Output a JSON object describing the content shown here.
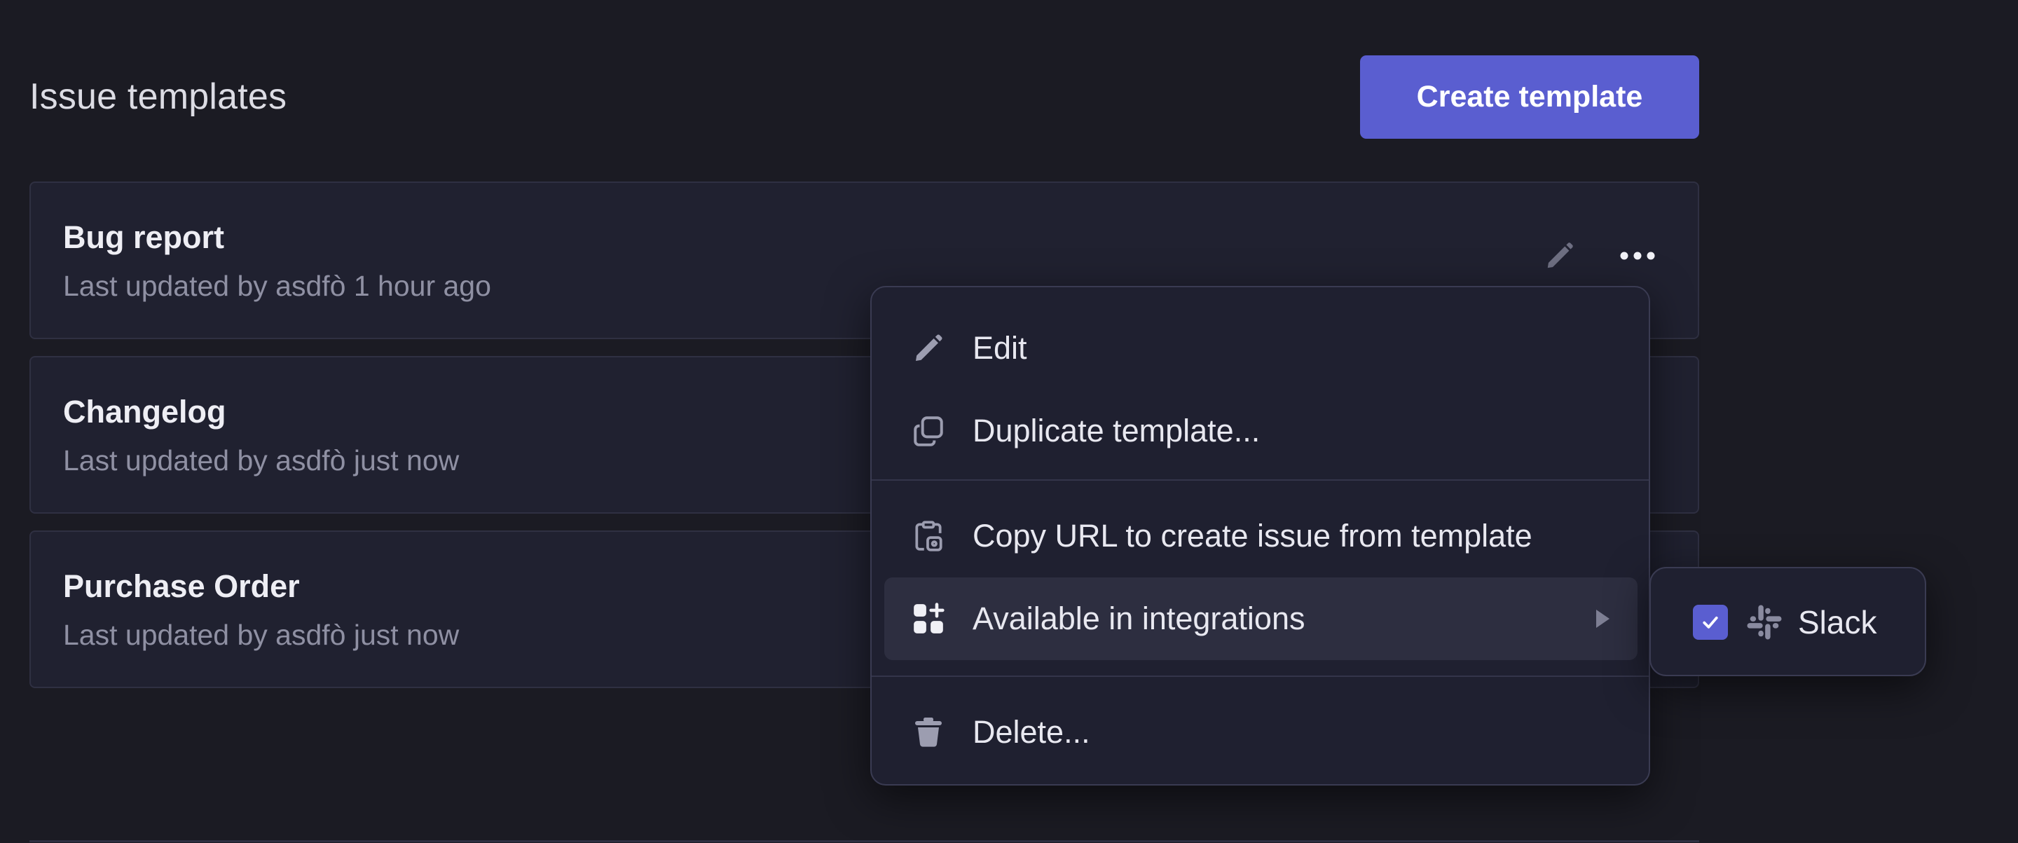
{
  "page": {
    "title": "Issue templates",
    "create_button_label": "Create template"
  },
  "templates": [
    {
      "name": "Bug report",
      "meta": "Last updated by asdfò 1 hour ago"
    },
    {
      "name": "Changelog",
      "meta": "Last updated by asdfò just now"
    },
    {
      "name": "Purchase Order",
      "meta": "Last updated by asdfò just now"
    }
  ],
  "context_menu": {
    "items": [
      {
        "label": "Edit",
        "icon": "pencil-icon"
      },
      {
        "label": "Duplicate template...",
        "icon": "duplicate-icon"
      },
      {
        "label": "Copy URL to create issue from template",
        "icon": "clipboard-link-icon"
      },
      {
        "label": "Available in integrations",
        "icon": "add-app-icon",
        "has_submenu": true,
        "active": true
      },
      {
        "label": "Delete...",
        "icon": "trash-icon"
      }
    ]
  },
  "integrations_submenu": {
    "items": [
      {
        "label": "Slack",
        "icon": "slack-icon",
        "checked": true
      }
    ]
  },
  "colors": {
    "background": "#1b1b23",
    "card": "#202130",
    "accent": "#5a5ed0",
    "menu": "#1f2030",
    "menu_active": "#2d2e40"
  }
}
